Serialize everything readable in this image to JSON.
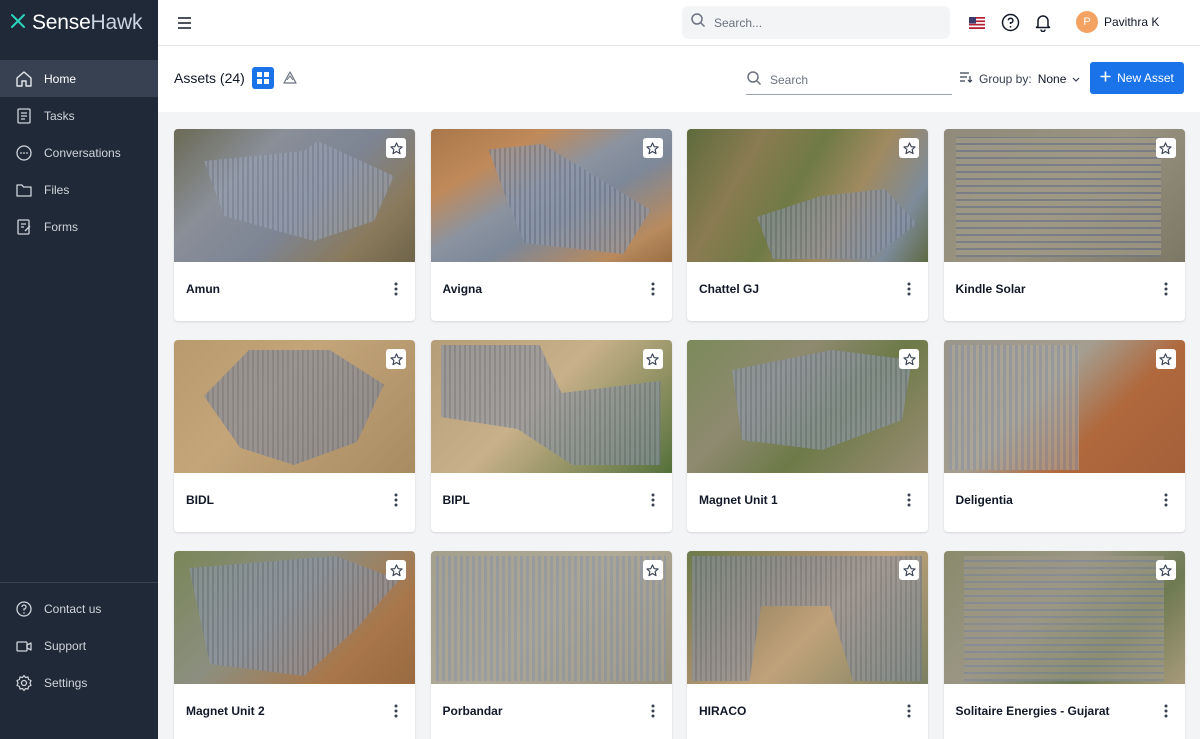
{
  "app": {
    "logo_sense": "Sense",
    "logo_hawk": "Hawk"
  },
  "sidebar": {
    "top_items": [
      {
        "label": "Home",
        "icon": "home-icon"
      },
      {
        "label": "Tasks",
        "icon": "tasks-icon"
      },
      {
        "label": "Conversations",
        "icon": "conversations-icon"
      },
      {
        "label": "Files",
        "icon": "folder-icon"
      },
      {
        "label": "Forms",
        "icon": "forms-icon"
      }
    ],
    "bottom_items": [
      {
        "label": "Contact us",
        "icon": "help-circle-icon"
      },
      {
        "label": "Support",
        "icon": "video-icon"
      },
      {
        "label": "Settings",
        "icon": "gear-icon"
      }
    ]
  },
  "topbar": {
    "search_placeholder": "Search...",
    "user_initial": "P",
    "user_name": "Pavithra K"
  },
  "toolbar": {
    "assets_title": "Assets (24)",
    "search_placeholder": "Search",
    "group_by_label": "Group by:",
    "group_by_value": "None",
    "new_asset_label": "New Asset"
  },
  "assets": [
    {
      "name": "Amun"
    },
    {
      "name": "Avigna"
    },
    {
      "name": "Chattel GJ"
    },
    {
      "name": "Kindle Solar"
    },
    {
      "name": "BIDL"
    },
    {
      "name": "BIPL"
    },
    {
      "name": "Magnet Unit 1"
    },
    {
      "name": "Deligentia"
    },
    {
      "name": "Magnet Unit 2"
    },
    {
      "name": "Porbandar"
    },
    {
      "name": "HIRACO"
    },
    {
      "name": "Solitaire Energies - Gujarat"
    }
  ],
  "colors": {
    "sidebar_bg": "#1f2937",
    "accent": "#1a73e8",
    "logo_accent": "#2dd4bf",
    "avatar_bg": "#f4a261"
  }
}
